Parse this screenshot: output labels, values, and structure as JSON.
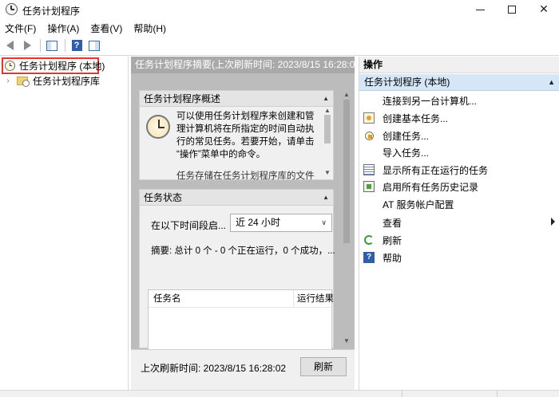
{
  "window": {
    "title": "任务计划程序",
    "minimize_glyph": "—",
    "maximize_glyph": "☐",
    "close_glyph": "✕"
  },
  "menu": {
    "items": [
      "文件(F)",
      "操作(A)",
      "查看(V)",
      "帮助(H)"
    ]
  },
  "toolbar": {
    "icons": [
      "back-arrow-icon",
      "forward-arrow-icon",
      "show-pane-icon",
      "help-icon",
      "action-pane-icon"
    ]
  },
  "tree": {
    "root_label": "任务计划程序 (本地)",
    "child_label": "任务计划程序库",
    "root_highlight_color": "#e8352c"
  },
  "middle": {
    "header": "任务计划程序摘要(上次刷新时间: 2023/8/15 16:28:02)",
    "overview": {
      "title": "任务计划程序概述",
      "lines": [
        "可以使用任务计划程序来创建和管",
        "理计算机将在所指定的时间自动执",
        "行的常见任务。若要开始，请单击",
        "“操作”菜单中的命令。"
      ],
      "more_text": "任务存储在任务计划程序库的文件"
    },
    "status": {
      "title": "任务状态",
      "period_label": "在以下时间段启...",
      "period_value": "近 24 小时",
      "summary": "摘要: 总计 0 个 - 0 个正在运行，0 个成功，...",
      "columns": [
        "任务名",
        "运行结果"
      ]
    },
    "footer": {
      "last_refresh": "上次刷新时间: 2023/8/15 16:28:02",
      "refresh_button": "刷新"
    }
  },
  "actions": {
    "title": "操作",
    "group": "任务计划程序 (本地)",
    "items": [
      {
        "label": "连接到另一台计算机...",
        "icon": "blank-icon"
      },
      {
        "label": "创建基本任务...",
        "icon": "wizard-icon"
      },
      {
        "label": "创建任务...",
        "icon": "create-task-icon"
      },
      {
        "label": "导入任务...",
        "icon": "blank-icon"
      },
      {
        "label": "显示所有正在运行的任务",
        "icon": "running-tasks-icon"
      },
      {
        "label": "启用所有任务历史记录",
        "icon": "history-icon"
      },
      {
        "label": "AT 服务帐户配置",
        "icon": "blank-icon"
      },
      {
        "label": "查看",
        "icon": "blank-icon",
        "submenu": true
      },
      {
        "label": "刷新",
        "icon": "refresh-icon"
      },
      {
        "label": "帮助",
        "icon": "help-icon"
      }
    ]
  }
}
